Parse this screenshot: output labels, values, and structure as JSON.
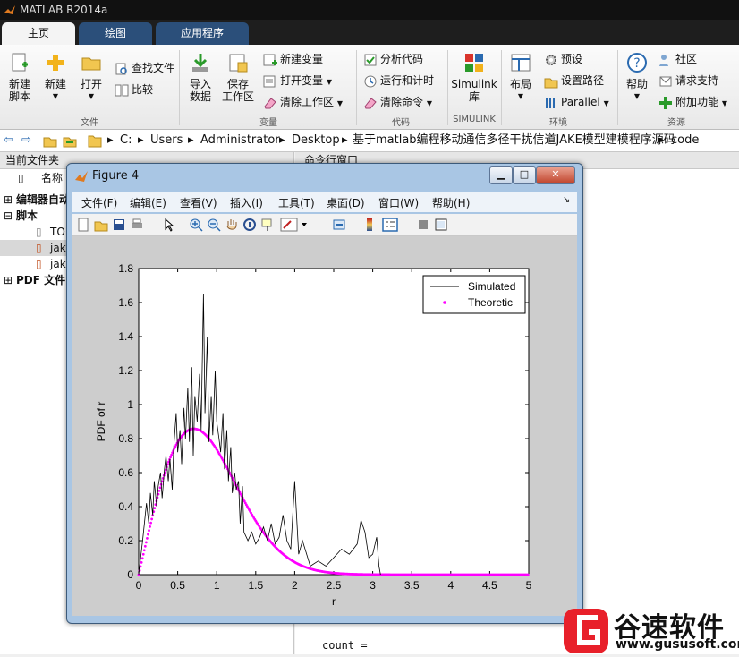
{
  "app": {
    "title": "MATLAB R2014a"
  },
  "tabs": [
    {
      "label": "主页"
    },
    {
      "label": "绘图"
    },
    {
      "label": "应用程序"
    }
  ],
  "ribbon": {
    "new_script": "新建\n脚本",
    "new": "新建",
    "open": "打开",
    "find_files": "查找文件",
    "compare": "比较",
    "import_data": "导入\n数据",
    "save_workspace": "保存\n工作区",
    "new_variable": "新建变量",
    "open_variable": "打开变量",
    "clear_workspace": "清除工作区",
    "analyze_code": "分析代码",
    "run_and_time": "运行和计时",
    "clear_commands": "清除命令",
    "simulink_library": "Simulink\n库",
    "layout": "布局",
    "preferences": "预设",
    "set_path": "设置路径",
    "parallel": "Parallel",
    "help": "帮助",
    "community": "社区",
    "request_support": "请求支持",
    "add_ons": "附加功能",
    "groups": {
      "file": "文件",
      "variable": "变量",
      "code": "代码",
      "simulink": "SIMULINK",
      "environment": "环境",
      "resources": "资源"
    }
  },
  "address": {
    "parts": [
      "C:",
      "Users",
      "Administrator",
      "Desktop",
      "基于matlab编程移动通信多径干扰信道JAKE模型建模程序源码",
      "code"
    ]
  },
  "left_panel": {
    "title": "当前文件夹",
    "column_name": "名称",
    "rows": [
      {
        "label": "编辑器自动"
      },
      {
        "label": "脚本"
      },
      {
        "label": "TO"
      },
      {
        "label": "jak"
      },
      {
        "label": "jak"
      },
      {
        "label": "PDF 文件"
      }
    ]
  },
  "command_window": {
    "title": "命令行窗口",
    "output": "count ="
  },
  "figure": {
    "title": "Figure 4",
    "menu": [
      "文件(F)",
      "编辑(E)",
      "查看(V)",
      "插入(I)",
      "工具(T)",
      "桌面(D)",
      "窗口(W)",
      "帮助(H)"
    ]
  },
  "chart_data": {
    "type": "line",
    "xlabel": "r",
    "ylabel": "PDF of r",
    "xlim": [
      0,
      5
    ],
    "ylim": [
      0,
      1.8
    ],
    "xticks": [
      0,
      0.5,
      1,
      1.5,
      2,
      2.5,
      3,
      3.5,
      4,
      4.5,
      5
    ],
    "yticks": [
      0,
      0.2,
      0.4,
      0.6,
      0.8,
      1,
      1.2,
      1.4,
      1.6,
      1.8
    ],
    "tick_labels_x": [
      "0",
      "0.5",
      "1",
      "1.5",
      "2",
      "2.5",
      "3",
      "3.5",
      "4",
      "4.5",
      "5"
    ],
    "tick_labels_y": [
      "0",
      "0.2",
      "0.4",
      "0.6",
      "0.8",
      "1",
      "1.2",
      "1.4",
      "1.6",
      "1.8"
    ],
    "legend_position": "top-right",
    "series": [
      {
        "name": "Simulated",
        "color": "#000000",
        "style": "line",
        "x": [
          0.0,
          0.05,
          0.1,
          0.13,
          0.15,
          0.18,
          0.2,
          0.23,
          0.25,
          0.28,
          0.3,
          0.33,
          0.35,
          0.38,
          0.4,
          0.43,
          0.45,
          0.48,
          0.5,
          0.53,
          0.55,
          0.58,
          0.6,
          0.63,
          0.65,
          0.68,
          0.7,
          0.72,
          0.75,
          0.78,
          0.8,
          0.83,
          0.85,
          0.88,
          0.9,
          0.93,
          0.95,
          0.98,
          1.0,
          1.03,
          1.05,
          1.08,
          1.1,
          1.13,
          1.15,
          1.18,
          1.2,
          1.23,
          1.25,
          1.28,
          1.3,
          1.33,
          1.35,
          1.4,
          1.45,
          1.5,
          1.55,
          1.6,
          1.65,
          1.7,
          1.75,
          1.8,
          1.85,
          1.9,
          1.95,
          2.0,
          2.05,
          2.1,
          2.2,
          2.3,
          2.4,
          2.5,
          2.6,
          2.7,
          2.8,
          2.85,
          2.9,
          2.95,
          3.0,
          3.05,
          3.08,
          3.1
        ],
        "y": [
          0.0,
          0.2,
          0.42,
          0.3,
          0.48,
          0.35,
          0.55,
          0.4,
          0.52,
          0.6,
          0.45,
          0.62,
          0.7,
          0.55,
          0.68,
          0.5,
          0.75,
          0.95,
          0.72,
          0.85,
          0.65,
          0.98,
          0.8,
          1.1,
          0.78,
          1.22,
          0.7,
          1.05,
          0.9,
          1.18,
          0.85,
          1.65,
          0.95,
          1.4,
          0.78,
          1.05,
          0.82,
          1.2,
          0.9,
          0.8,
          0.72,
          0.95,
          0.62,
          0.85,
          0.55,
          0.75,
          0.48,
          0.6,
          0.5,
          0.55,
          0.3,
          0.52,
          0.25,
          0.2,
          0.25,
          0.18,
          0.22,
          0.28,
          0.2,
          0.3,
          0.18,
          0.22,
          0.35,
          0.2,
          0.15,
          0.55,
          0.12,
          0.2,
          0.05,
          0.08,
          0.05,
          0.1,
          0.15,
          0.12,
          0.18,
          0.32,
          0.25,
          0.1,
          0.12,
          0.22,
          0.05,
          0.0
        ]
      },
      {
        "name": "Theoretic",
        "color": "#ff00ff",
        "style": "markers",
        "formula": "rayleigh sigma=0.707"
      }
    ]
  },
  "watermark": {
    "brand": "谷速软件",
    "url": "www.gususoft.com"
  },
  "colors": {
    "theoretic": "#ff00ff",
    "simulated": "#000000",
    "ribbon_tab": "#2b4f7a",
    "brand_red": "#e8202a"
  }
}
